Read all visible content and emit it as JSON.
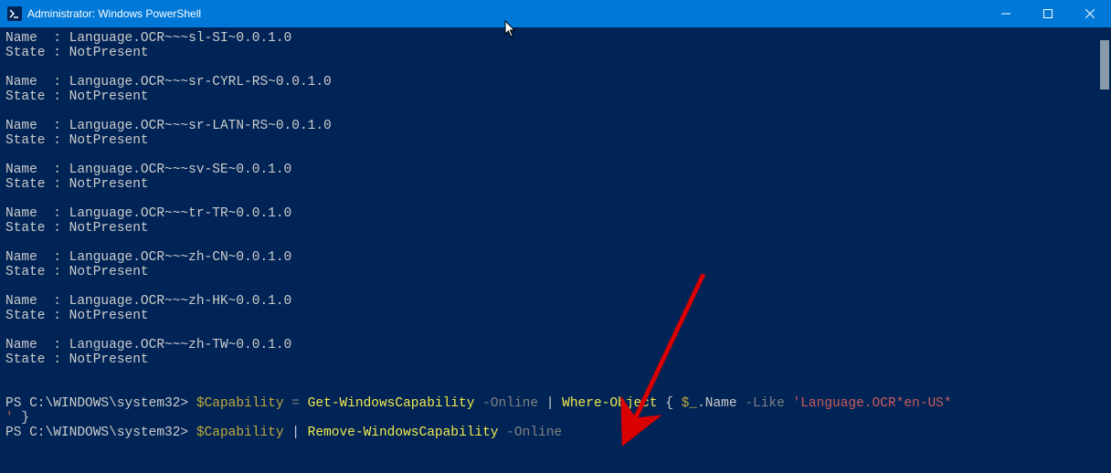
{
  "window": {
    "title": "Administrator: Windows PowerShell"
  },
  "labels": {
    "name": "Name",
    "state": "State",
    "sep": " : "
  },
  "entries": [
    {
      "name": "Language.OCR~~~sl-SI~0.0.1.0",
      "state": "NotPresent"
    },
    {
      "name": "Language.OCR~~~sr-CYRL-RS~0.0.1.0",
      "state": "NotPresent"
    },
    {
      "name": "Language.OCR~~~sr-LATN-RS~0.0.1.0",
      "state": "NotPresent"
    },
    {
      "name": "Language.OCR~~~sv-SE~0.0.1.0",
      "state": "NotPresent"
    },
    {
      "name": "Language.OCR~~~tr-TR~0.0.1.0",
      "state": "NotPresent"
    },
    {
      "name": "Language.OCR~~~zh-CN~0.0.1.0",
      "state": "NotPresent"
    },
    {
      "name": "Language.OCR~~~zh-HK~0.0.1.0",
      "state": "NotPresent"
    },
    {
      "name": "Language.OCR~~~zh-TW~0.0.1.0",
      "state": "NotPresent"
    }
  ],
  "cmd1": {
    "prompt": "PS C:\\WINDOWS\\system32> ",
    "var": "$Capability",
    "assign": " = ",
    "cmd": "Get-WindowsCapability",
    "flag": " -Online ",
    "pipe": "| ",
    "where": "Where-Object",
    "brace_open": " { ",
    "dollar_under": "$_",
    "dot_name": ".Name",
    "like": " -Like ",
    "str_a": "'Language.OCR*en-US*",
    "str_b": "'",
    "brace_close": " }"
  },
  "cmd2": {
    "prompt": "PS C:\\WINDOWS\\system32> ",
    "var": "$Capability",
    "pipe": " | ",
    "cmd": "Remove-WindowsCapability",
    "flag": " -Online"
  }
}
